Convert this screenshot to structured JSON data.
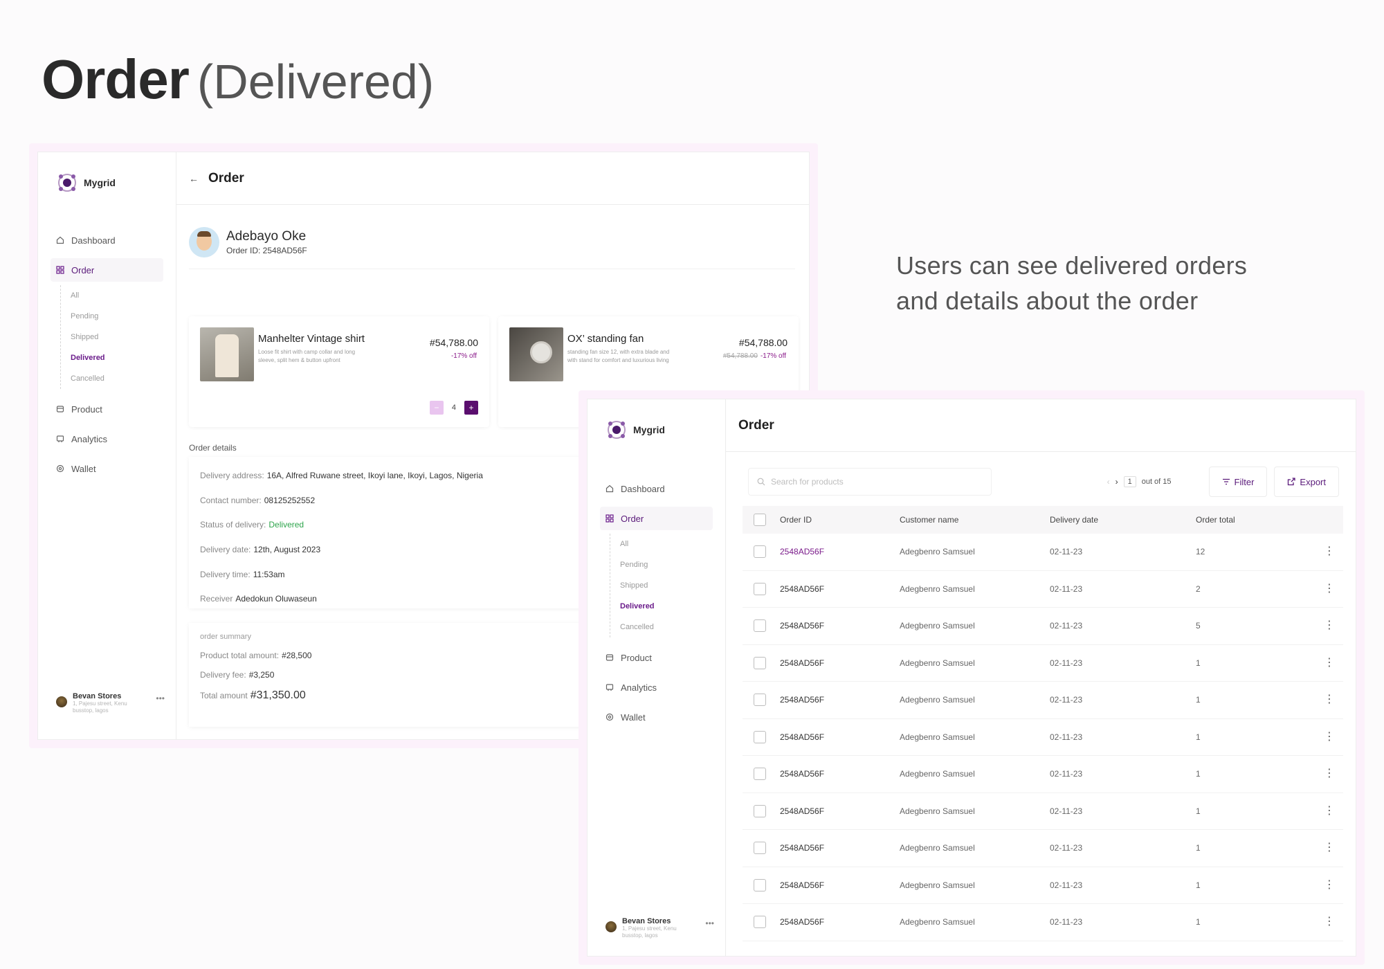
{
  "heading": {
    "bold": "Order",
    "light": "(Delivered)"
  },
  "caption": "Users can see delivered orders and details about the order",
  "colors": {
    "brand": "#5a0e6e",
    "accent": "#7a1a8a",
    "success": "#2ca44a",
    "frame": "#fcf1fb"
  },
  "sidebar": {
    "brand": "Mygrid",
    "items": [
      {
        "label": "Dashboard",
        "icon": "home-icon"
      },
      {
        "label": "Order",
        "icon": "grid-icon"
      },
      {
        "label": "Product",
        "icon": "box-icon"
      },
      {
        "label": "Analytics",
        "icon": "chart-icon"
      },
      {
        "label": "Wallet",
        "icon": "wallet-icon"
      }
    ],
    "sub_items": [
      "All",
      "Pending",
      "Shipped",
      "Delivered",
      "Cancelled"
    ],
    "profile": {
      "name": "Bevan Stores",
      "address": "1, Pajesu street, Kenu busstop, lagos",
      "more": "•••"
    }
  },
  "detail": {
    "title": "Order",
    "customer": {
      "name": "Adebayo Oke",
      "order_id": "Order ID: 2548AD56F"
    },
    "products": [
      {
        "name": "Manhelter Vintage shirt",
        "description": "Loose fit shirt with camp collar and long sleeve, split hem & button upfront",
        "price": "#54,788.00",
        "old_price": "",
        "discount": "-17% off",
        "qty": "4",
        "image": "shirt-image"
      },
      {
        "name": "OX’ standing fan",
        "description": "standing fan size 12, with extra blade and with stand for comfort and luxurious living",
        "price": "#54,788.00",
        "old_price": "#54,788.00",
        "discount": "-17% off",
        "image": "fan-image"
      }
    ],
    "qty_minus": "−",
    "qty_plus": "+",
    "order_details_label": "Order details",
    "order_details": [
      {
        "label": "Delivery address:",
        "value": "16A, Alfred Ruwane street, Ikoyi lane, Ikoyi, Lagos, Nigeria"
      },
      {
        "label": "Contact number:",
        "value": "08125252552"
      },
      {
        "label": "Status of delivery:",
        "value": "Delivered"
      },
      {
        "label": "Delivery date:",
        "value": "12th, August 2023"
      },
      {
        "label": "Delivery time:",
        "value": "11:53am"
      },
      {
        "label": "Receiver",
        "value": "Adedokun Oluwaseun"
      }
    ],
    "summary": {
      "title": "order summary",
      "product_total_label": "Product total amount:",
      "product_total": "#28,500",
      "delivery_fee_label": "Delivery fee:",
      "delivery_fee": "#3,250",
      "total_label": "Total amount",
      "total": "#31,350.00"
    }
  },
  "list": {
    "title": "Order",
    "search_placeholder": "Search for products",
    "page": "1",
    "page_of": "out of 15",
    "filter_label": "Filter",
    "export_label": "Export",
    "columns": [
      "Order ID",
      "Customer name",
      "Delivery date",
      "Order total"
    ],
    "rows": [
      {
        "id": "2548AD56F",
        "name": "Adegbenro Samsuel",
        "date": "02-11-23",
        "total": "12"
      },
      {
        "id": "2548AD56F",
        "name": "Adegbenro Samsuel",
        "date": "02-11-23",
        "total": "2"
      },
      {
        "id": "2548AD56F",
        "name": "Adegbenro Samsuel",
        "date": "02-11-23",
        "total": "5"
      },
      {
        "id": "2548AD56F",
        "name": "Adegbenro Samsuel",
        "date": "02-11-23",
        "total": "1"
      },
      {
        "id": "2548AD56F",
        "name": "Adegbenro Samsuel",
        "date": "02-11-23",
        "total": "1"
      },
      {
        "id": "2548AD56F",
        "name": "Adegbenro Samsuel",
        "date": "02-11-23",
        "total": "1"
      },
      {
        "id": "2548AD56F",
        "name": "Adegbenro Samsuel",
        "date": "02-11-23",
        "total": "1"
      },
      {
        "id": "2548AD56F",
        "name": "Adegbenro Samsuel",
        "date": "02-11-23",
        "total": "1"
      },
      {
        "id": "2548AD56F",
        "name": "Adegbenro Samsuel",
        "date": "02-11-23",
        "total": "1"
      },
      {
        "id": "2548AD56F",
        "name": "Adegbenro Samsuel",
        "date": "02-11-23",
        "total": "1"
      },
      {
        "id": "2548AD56F",
        "name": "Adegbenro Samsuel",
        "date": "02-11-23",
        "total": "1"
      }
    ]
  }
}
